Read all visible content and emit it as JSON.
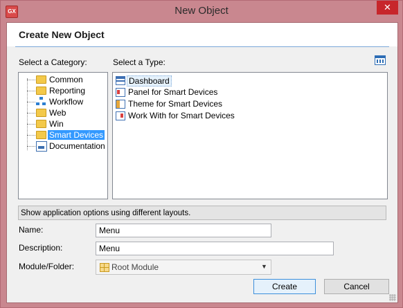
{
  "window": {
    "title": "New Object",
    "app_icon_text": "GX",
    "close_glyph": "✕"
  },
  "header": {
    "title": "Create New Object"
  },
  "labels": {
    "category": "Select a Category:",
    "type": "Select a Type:",
    "name": "Name:",
    "description": "Description:",
    "module": "Module/Folder:"
  },
  "categories": [
    {
      "label": "Common",
      "icon": "folder-icon"
    },
    {
      "label": "Reporting",
      "icon": "folder-icon"
    },
    {
      "label": "Workflow",
      "icon": "workflow-icon"
    },
    {
      "label": "Web",
      "icon": "folder-icon"
    },
    {
      "label": "Win",
      "icon": "folder-icon"
    },
    {
      "label": "Smart Devices",
      "icon": "folder-icon",
      "selected": true
    },
    {
      "label": "Documentation",
      "icon": "documentation-icon"
    }
  ],
  "types": [
    {
      "label": "Dashboard",
      "icon": "dashboard-icon",
      "selected": true
    },
    {
      "label": "Panel for Smart Devices",
      "icon": "panel-icon"
    },
    {
      "label": "Theme for Smart Devices",
      "icon": "theme-icon"
    },
    {
      "label": "Work With for Smart Devices",
      "icon": "work-with-icon"
    }
  ],
  "description_bar": "Show application options using different layouts.",
  "form": {
    "name_value": "Menu",
    "description_value": "Menu",
    "module_value": "Root Module",
    "module_chevron": "▼"
  },
  "buttons": {
    "create": "Create",
    "cancel": "Cancel"
  },
  "colors": {
    "window_frame": "#c9878f",
    "selection": "#3399ff",
    "close_button": "#c7262b"
  }
}
